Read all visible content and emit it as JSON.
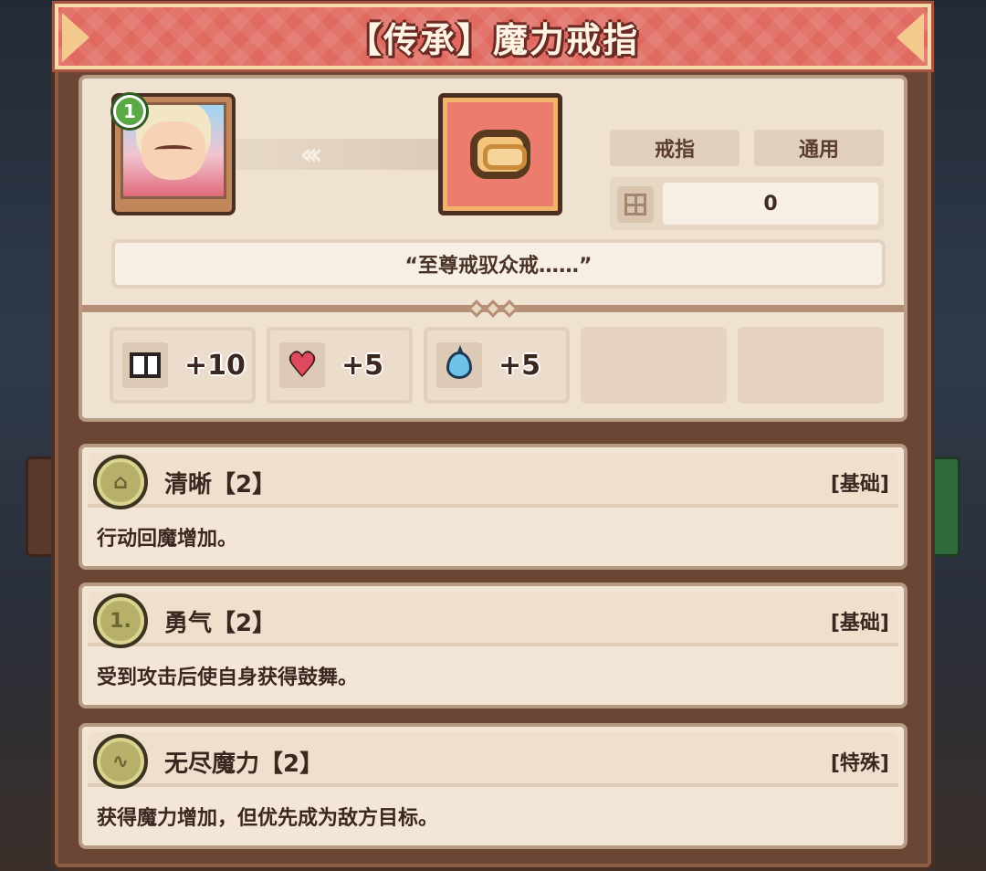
{
  "title": "【传承】魔力戒指",
  "hero": {
    "level": "1"
  },
  "item": {
    "tags": [
      "戒指",
      "通用"
    ],
    "count": "0",
    "flavor": "“至尊戒驭众戒……”",
    "arrows": "‹‹‹"
  },
  "stats": [
    {
      "icon": "book-icon",
      "value": "+10"
    },
    {
      "icon": "heart-icon",
      "value": "+5"
    },
    {
      "icon": "mana-drop-icon",
      "value": "+5"
    }
  ],
  "skills": [
    {
      "name": "清晰【2】",
      "type": "[基础]",
      "desc": "行动回魔增加。",
      "medal": "⌂"
    },
    {
      "name": "勇气【2】",
      "type": "[基础]",
      "desc": "受到攻击后使自身获得鼓舞。",
      "medal": "1."
    },
    {
      "name": "无尽魔力【2】",
      "type": "[特殊]",
      "desc": "获得魔力增加，但优先成为敌方目标。",
      "medal": "∿"
    }
  ],
  "colors": {
    "title_bg": "#e06a60",
    "panel": "#6b4634",
    "card": "#f3e6d6",
    "level_badge": "#5aa846",
    "item_frame": "#ec7c6e"
  }
}
